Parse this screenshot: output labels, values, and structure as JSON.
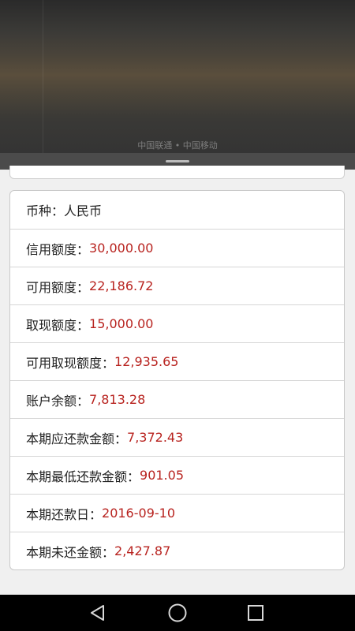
{
  "status": {
    "carrier": "中国联通 • 中国移动"
  },
  "account": {
    "rows": [
      {
        "label": "币种：",
        "value": "人民币"
      },
      {
        "label": "信用额度：",
        "value": "30,000.00"
      },
      {
        "label": "可用额度：",
        "value": "22,186.72"
      },
      {
        "label": "取现额度：",
        "value": "15,000.00"
      },
      {
        "label": "可用取现额度：",
        "value": "12,935.65"
      },
      {
        "label": "账户余额：",
        "value": "7,813.28"
      },
      {
        "label": "本期应还款金额：",
        "value": "7,372.43"
      },
      {
        "label": "本期最低还款金额：",
        "value": "901.05"
      },
      {
        "label": "本期还款日：",
        "value": "2016-09-10"
      },
      {
        "label": "本期未还金额：",
        "value": "2,427.87"
      }
    ]
  },
  "colors": {
    "value_red": "#b8231f",
    "label_text": "#222222",
    "page_bg": "#f0f0f0"
  },
  "navbar": {
    "icons": [
      "back-icon",
      "home-icon",
      "recents-icon"
    ]
  }
}
